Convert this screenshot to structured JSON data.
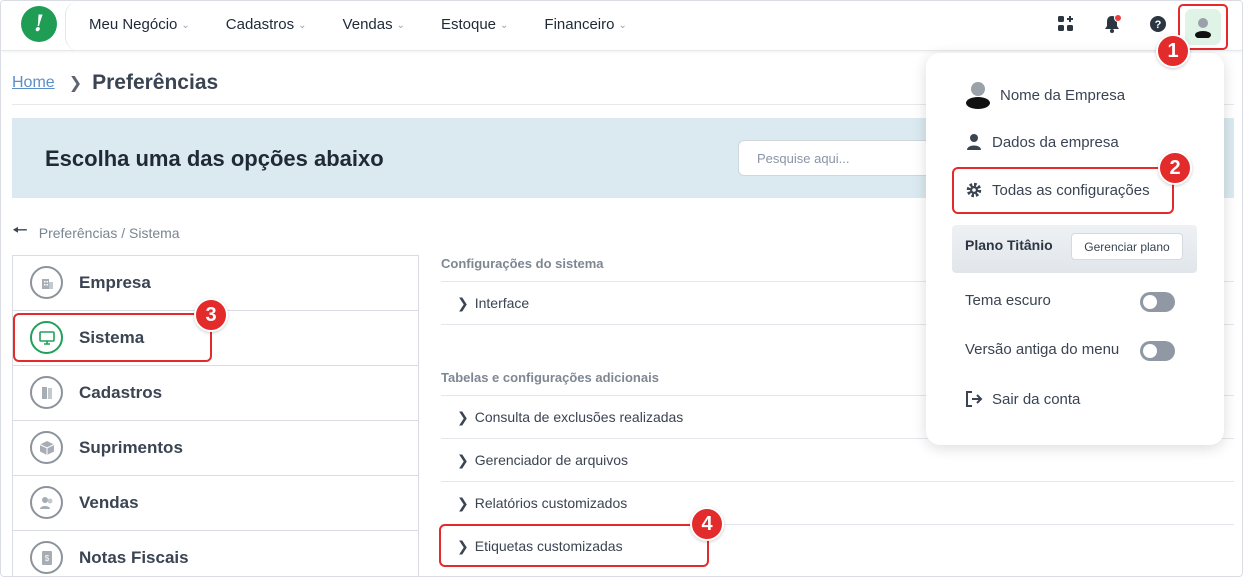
{
  "topbar": {
    "logo_letter": "!",
    "nav": [
      {
        "label": "Meu Negócio"
      },
      {
        "label": "Cadastros"
      },
      {
        "label": "Vendas"
      },
      {
        "label": "Estoque"
      },
      {
        "label": "Financeiro"
      }
    ],
    "icons": [
      "apps-grid-icon",
      "bell-icon",
      "help-icon",
      "user-avatar-icon"
    ]
  },
  "breadcrumb": {
    "home": "Home",
    "separator": ">",
    "title": "Preferências"
  },
  "banner": {
    "title": "Escolha uma das opções abaixo",
    "search_placeholder": "Pesquise aqui..."
  },
  "back": {
    "path": "Preferências / Sistema"
  },
  "left_menu": [
    {
      "label": "Empresa",
      "icon": "building-icon"
    },
    {
      "label": "Sistema",
      "icon": "monitor-icon",
      "active": true
    },
    {
      "label": "Cadastros",
      "icon": "book-icon"
    },
    {
      "label": "Suprimentos",
      "icon": "box-icon"
    },
    {
      "label": "Vendas",
      "icon": "people-icon"
    },
    {
      "label": "Notas Fiscais",
      "icon": "receipt-icon"
    }
  ],
  "content": {
    "section1_title": "Configurações do sistema",
    "section1_rows": [
      "Interface"
    ],
    "section2_title": "Tabelas e configurações adicionais",
    "section2_rows": [
      "Consulta de exclusões realizadas",
      "Gerenciador de arquivos",
      "Relatórios customizados",
      "Etiquetas customizadas"
    ]
  },
  "dropdown": {
    "company_name": "Nome da Empresa",
    "company_data": "Dados da empresa",
    "all_settings": "Todas as configurações",
    "plan_name": "Plano Titânio",
    "manage_plan": "Gerenciar plano",
    "dark_theme": "Tema escuro",
    "old_menu": "Versão antiga do menu",
    "logout": "Sair da conta"
  },
  "badges": [
    "1",
    "2",
    "3",
    "4"
  ],
  "colors": {
    "accent_green": "#1f9d55",
    "highlight_red": "#e32b2b",
    "banner_bg": "#dbe9f1"
  }
}
